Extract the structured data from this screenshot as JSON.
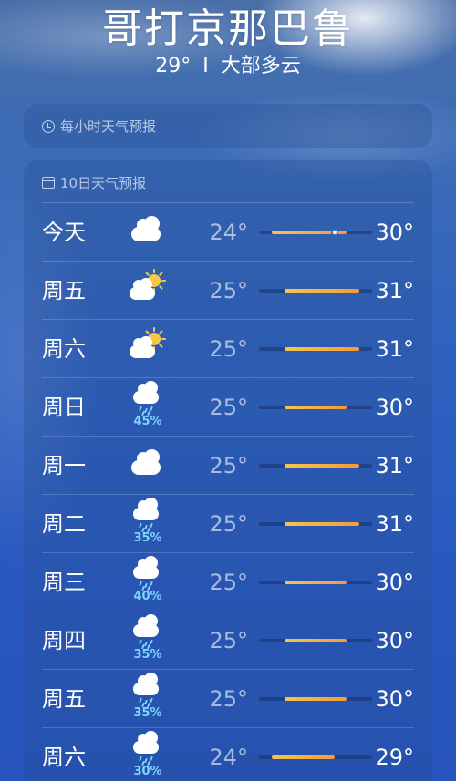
{
  "header": {
    "city": "哥打京那巴鲁",
    "current_temp": "29°",
    "separator": "I",
    "condition": "大部多云"
  },
  "hourly": {
    "title": "每小时天气预报",
    "icon": "clock-icon"
  },
  "daily": {
    "title": "10日天气预报",
    "icon": "calendar-icon",
    "range_min": 23,
    "range_max": 32,
    "days": [
      {
        "day": "今天",
        "icon": "cloud-icon",
        "precip": "",
        "low": "24°",
        "high": "30°",
        "low_v": 24,
        "high_v": 30,
        "current_v": 29
      },
      {
        "day": "周五",
        "icon": "partly-sunny-icon",
        "precip": "",
        "low": "25°",
        "high": "31°",
        "low_v": 25,
        "high_v": 31
      },
      {
        "day": "周六",
        "icon": "partly-sunny-icon",
        "precip": "",
        "low": "25°",
        "high": "31°",
        "low_v": 25,
        "high_v": 31
      },
      {
        "day": "周日",
        "icon": "rain-icon",
        "precip": "45%",
        "low": "25°",
        "high": "30°",
        "low_v": 25,
        "high_v": 30
      },
      {
        "day": "周一",
        "icon": "cloud-icon",
        "precip": "",
        "low": "25°",
        "high": "31°",
        "low_v": 25,
        "high_v": 31
      },
      {
        "day": "周二",
        "icon": "rain-icon",
        "precip": "35%",
        "low": "25°",
        "high": "31°",
        "low_v": 25,
        "high_v": 31
      },
      {
        "day": "周三",
        "icon": "rain-icon",
        "precip": "40%",
        "low": "25°",
        "high": "30°",
        "low_v": 25,
        "high_v": 30
      },
      {
        "day": "周四",
        "icon": "rain-icon",
        "precip": "35%",
        "low": "25°",
        "high": "30°",
        "low_v": 25,
        "high_v": 30
      },
      {
        "day": "周五",
        "icon": "rain-icon",
        "precip": "35%",
        "low": "25°",
        "high": "30°",
        "low_v": 25,
        "high_v": 30
      },
      {
        "day": "周六",
        "icon": "rain-icon",
        "precip": "30%",
        "low": "24°",
        "high": "29°",
        "low_v": 24,
        "high_v": 29
      }
    ]
  }
}
